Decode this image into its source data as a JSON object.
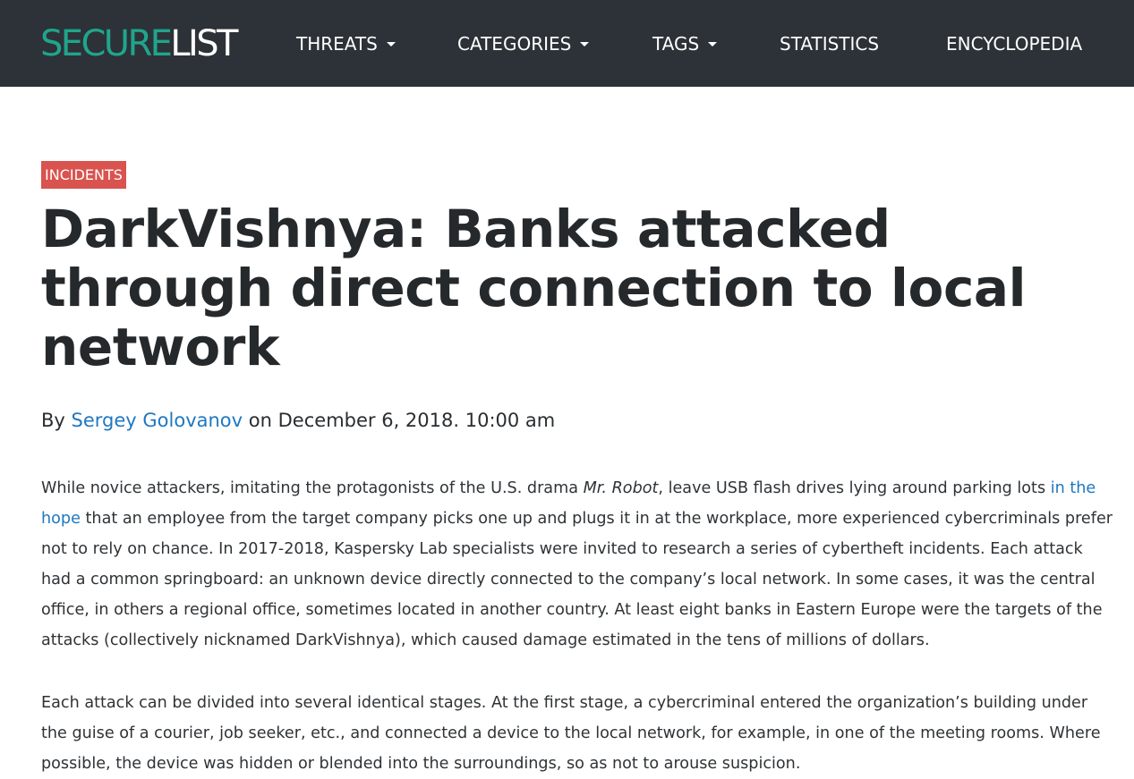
{
  "header": {
    "logo": {
      "part1": "SECURE",
      "part2": "LIST"
    },
    "nav": [
      {
        "label": "THREATS",
        "has_dropdown": true
      },
      {
        "label": "CATEGORIES",
        "has_dropdown": true
      },
      {
        "label": "TAGS",
        "has_dropdown": true
      },
      {
        "label": "STATISTICS",
        "has_dropdown": false
      },
      {
        "label": "ENCYCLOPEDIA",
        "has_dropdown": false
      }
    ]
  },
  "article": {
    "category_badge": "INCIDENTS",
    "title": "DarkVishnya: Banks attacked through direct connection to local network",
    "byline": {
      "prefix": "By",
      "author": "Sergey Golovanov",
      "date_prefix": "on",
      "date": "December 6, 2018. 10:00 am"
    },
    "paragraph1": {
      "t1": "While novice attackers, imitating the protagonists of the U.S. drama ",
      "em": "Mr. Robot",
      "t2": ", leave USB flash drives lying around parking lots ",
      "link": "in the hope",
      "t3": " that an employee from the target company picks one up and plugs it in at the workplace, more experienced cybercriminals prefer not to rely on chance. In 2017-2018, Kaspersky Lab specialists were invited to research a series of cybertheft incidents. Each attack had a common springboard: an unknown device directly connected to the company’s local network. In some cases, it was the central office, in others a regional office, sometimes located in another country. At least eight banks in Eastern Europe were the targets of the attacks (collectively nicknamed DarkVishnya), which caused damage estimated in the tens of millions of dollars."
    },
    "paragraph2": "Each attack can be divided into several identical stages. At the first stage, a cybercriminal entered the organization’s building under the guise of a courier, job seeker, etc., and connected a device to the local network, for example, in one of the meeting rooms. Where possible, the device was hidden or blended into the surroundings, so as not to arouse suspicion."
  },
  "colors": {
    "header_bg": "#2c3237",
    "logo_accent": "#20a58c",
    "badge_bg": "#d9534f",
    "link": "#1f78c1"
  }
}
